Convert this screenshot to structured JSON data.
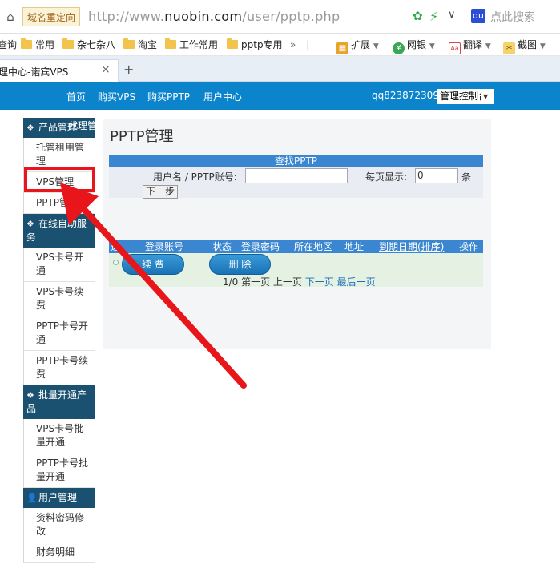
{
  "browser": {
    "redirect_tag": "域名重定向",
    "url_prefix": "http://www.",
    "url_domain": "nuobin.com",
    "url_path": "/user/pptp.php",
    "search_placeholder": "点此搜索",
    "bookmarks": [
      "查询",
      "常用",
      "杂七杂八",
      "淘宝",
      "工作常用",
      "pptp专用"
    ],
    "more_bookmarks": "»",
    "toolbar": {
      "extend": "扩展",
      "bank": "网银",
      "translate": "翻译",
      "screenshot": "截图"
    },
    "tab_title": "管理中心-诺宾VPS",
    "tab_close": "×",
    "new_tab": "+"
  },
  "site_nav": {
    "links": [
      "首页",
      "购买VPS",
      "购买PPTP",
      "用户中心"
    ],
    "username": "qq823872309",
    "control_panel": "管理控制台"
  },
  "sidebar": {
    "overlay_text": "代理管",
    "sections": [
      {
        "title": "产品管理",
        "icon": "cubes-icon",
        "items": [
          "托管租用管理",
          "VPS管理",
          "PPTP管理"
        ]
      },
      {
        "title": "在线自助服务",
        "icon": "cubes-icon",
        "items": [
          "VPS卡号开通",
          "VPS卡号续费",
          "PPTP卡号开通",
          "PPTP卡号续费"
        ]
      },
      {
        "title": "批量开通产品",
        "icon": "cubes-icon",
        "items": [
          "VPS卡号批量开通",
          "PPTP卡号批量开通"
        ]
      },
      {
        "title": "用户管理",
        "icon": "user-icon",
        "items": [
          "资料密码修改",
          "财务明细"
        ]
      }
    ]
  },
  "main": {
    "page_title": "PPTP管理",
    "search": {
      "header": "查找PPTP",
      "user_label": "用户名 / PPTP账号:",
      "user_value": "",
      "perpage_label": "每页显示:",
      "perpage_value": "0",
      "unit": "条",
      "next_button": "下一步"
    },
    "table": {
      "columns": [
        "选",
        "登录账号",
        "状态",
        "登录密码",
        "所在地区",
        "地址",
        "到期日期(排序)",
        "操作"
      ],
      "renew_button": "续 费",
      "delete_button": "删 除"
    },
    "pager": {
      "status": "1/0",
      "first": "第一页",
      "prev": "上一页",
      "next": "下一页",
      "last": "最后一页"
    }
  },
  "colors": {
    "nav_bg": "#0b84cc",
    "sidebar_head": "#1b5170",
    "table_head": "#3a86d0",
    "annotation_red": "#e8161a"
  }
}
